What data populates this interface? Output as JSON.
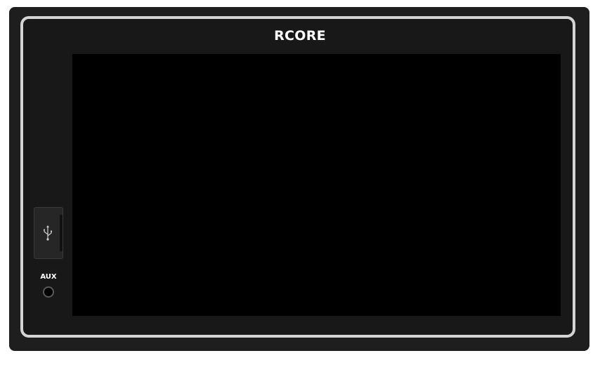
{
  "device": {
    "brand": "RCORE",
    "aux_label": "AUX"
  },
  "icons": {
    "usb": "usb-icon"
  },
  "colors": {
    "frame": "#1e1e1e",
    "bezel_border": "#d4d4d4",
    "screen": "#000000",
    "text": "#ffffff"
  }
}
